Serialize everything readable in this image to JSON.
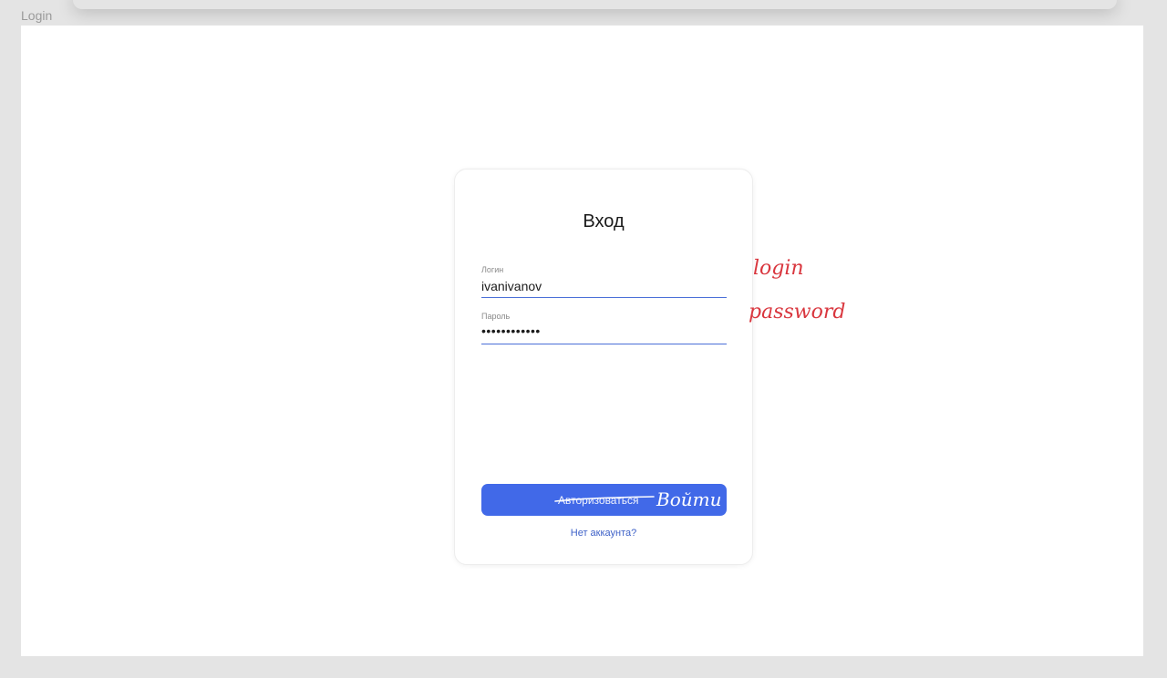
{
  "frame": {
    "label": "Login"
  },
  "card": {
    "title": "Вход",
    "login_field": {
      "label": "Логин",
      "value": "ivanivanov"
    },
    "password_field": {
      "label": "Пароль",
      "value": "••••••••••••"
    },
    "submit": {
      "old_label": "Авторизоваться",
      "new_label": "Войти"
    },
    "register_link": "Нет аккаунта?"
  },
  "annotations": {
    "login_note": "login",
    "password_note": "password",
    "color": "#d9363e"
  },
  "colors": {
    "accent": "#4169e8",
    "link": "#3f62c8",
    "field_underline": "#4a6fd8"
  }
}
